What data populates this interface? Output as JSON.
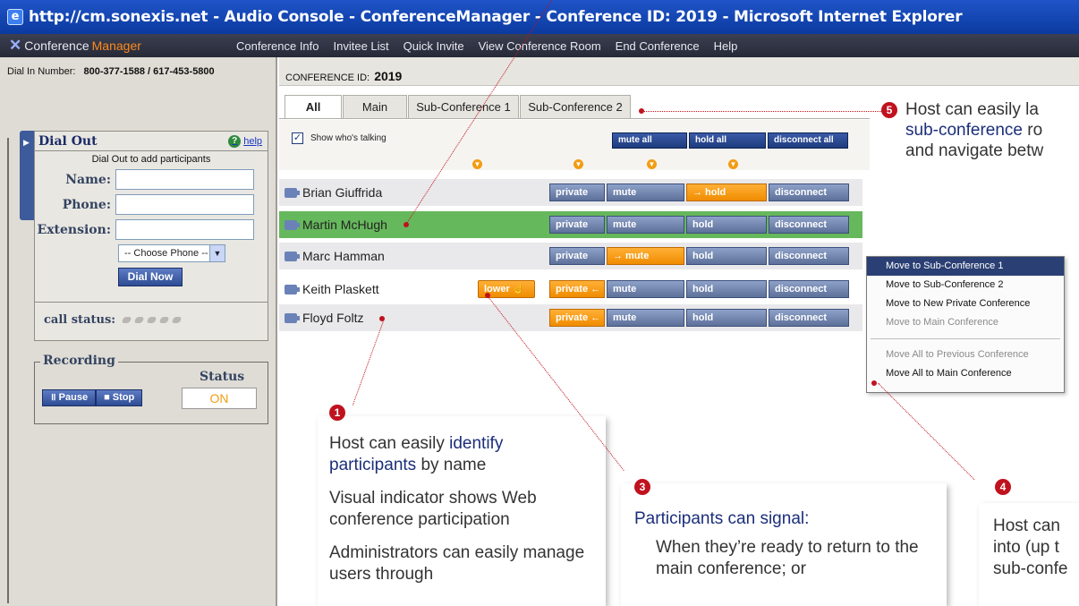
{
  "window": {
    "title": "http://cm.sonexis.net - Audio Console - ConferenceManager - Conference ID: 2019 - Microsoft Internet Explorer"
  },
  "menubar": {
    "logo_a": "Conference",
    "logo_b": "Manager",
    "items": [
      "Conference Info",
      "Invitee List",
      "Quick Invite",
      "View Conference Room",
      "End Conference",
      "Help"
    ]
  },
  "left": {
    "dialin_label": "Dial In Number:",
    "dialin_value": "800-377-1588 / 617-453-5800",
    "dialout": {
      "title": "Dial Out",
      "help": "help",
      "subtitle": "Dial Out to add participants",
      "name_label": "Name:",
      "phone_label": "Phone:",
      "ext_label": "Extension:",
      "choose_phone": "-- Choose Phone --",
      "dial_now": "Dial Now"
    },
    "call_status_label": "call status:",
    "recording": {
      "title": "Recording",
      "status_label": "Status",
      "pause": "Pause",
      "stop": "Stop",
      "status_value": "ON"
    }
  },
  "main": {
    "conf_id_label": "CONFERENCE ID:",
    "conf_id_value": "2019",
    "tabs": [
      "All",
      "Main",
      "Sub-Conference 1",
      "Sub-Conference 2"
    ],
    "show_talking": "Show who's talking",
    "mute_all": "mute all",
    "hold_all": "hold all",
    "disconnect_all": "disconnect all",
    "participants": [
      {
        "name": "Brian Giuffrida",
        "private": "private",
        "mute": "mute",
        "hold": "→ hold",
        "disconnect": "disconnect"
      },
      {
        "name": "Martin McHugh",
        "private": "private",
        "mute": "mute",
        "hold": "hold",
        "disconnect": "disconnect"
      },
      {
        "name": "Marc Hamman",
        "private": "private",
        "mute": "→ mute",
        "hold": "hold",
        "disconnect": "disconnect"
      },
      {
        "name": "Keith Plaskett",
        "private": "private ←",
        "mute": "mute",
        "hold": "hold",
        "disconnect": "disconnect",
        "lower": "lower"
      },
      {
        "name": "Floyd Foltz",
        "private": "private ←",
        "mute": "mute",
        "hold": "hold",
        "disconnect": "disconnect"
      }
    ]
  },
  "context_menu": {
    "items": [
      "Move to Sub-Conference 1",
      "Move to Sub-Conference 2",
      "Move to New Private Conference",
      "Move to Main Conference",
      "Move All to Previous Conference",
      "Move All to Main Conference"
    ]
  },
  "callouts": {
    "c1": {
      "num": "1",
      "line1a": "Host can easily ",
      "line1b": "identify",
      "line2a": "participants",
      "line2b": " by name",
      "p2": "Visual indicator shows Web conference participation",
      "p3": "Administrators can easily manage users through"
    },
    "c3": {
      "num": "3",
      "title": "Participants can signal:",
      "p1": "When they’re ready to return to the main conference; or"
    },
    "c4": {
      "num": "4",
      "l1": "Host can",
      "l2": "into (up t",
      "l3": "sub-confe"
    },
    "c5": {
      "num": "5",
      "l1": "Host can easily la",
      "l2a": "sub-conference",
      "l2b": " ro",
      "l3": "and navigate betw"
    }
  },
  "colors": {
    "title_blue": "#0b3a9f",
    "accent_orange": "#f39c12",
    "active_row_green": "#5cb85c",
    "callout_red": "#c0121e",
    "callout_emphasis": "#1b2e7a"
  }
}
